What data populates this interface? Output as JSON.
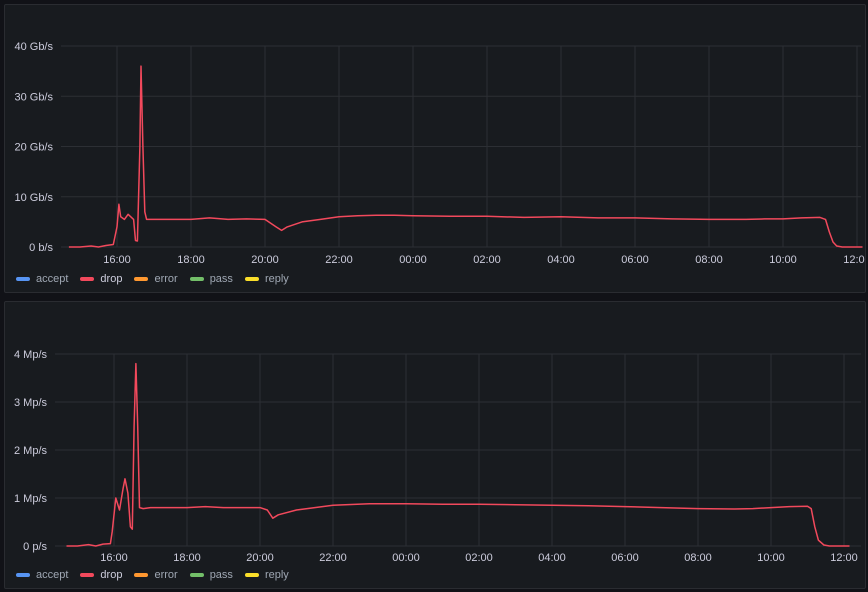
{
  "colors": {
    "accept": "#5794f2",
    "drop": "#f2495c",
    "error": "#ff9830",
    "pass": "#73bf69",
    "reply": "#fade2a"
  },
  "chart_data": [
    {
      "type": "line",
      "title": "",
      "xlabel": "",
      "ylabel": "",
      "unit": "b/s",
      "x_ticks": [
        "16:00",
        "18:00",
        "20:00",
        "22:00",
        "00:00",
        "02:00",
        "04:00",
        "06:00",
        "08:00",
        "10:00",
        "12:00"
      ],
      "y_ticks": [
        "0 b/s",
        "10 Gb/s",
        "20 Gb/s",
        "30 Gb/s",
        "40 Gb/s"
      ],
      "ylim_gbps": [
        0,
        40
      ],
      "xlim_hours": [
        14.7,
        36.15
      ],
      "grid": true,
      "legend_position": "bottom-left",
      "legend": [
        "accept",
        "drop",
        "error",
        "pass",
        "reply"
      ],
      "series": [
        {
          "name": "drop",
          "y_unit": "Gb/s",
          "points": [
            [
              14.7,
              0
            ],
            [
              15.0,
              0
            ],
            [
              15.3,
              0.2
            ],
            [
              15.5,
              0
            ],
            [
              15.7,
              0.3
            ],
            [
              15.9,
              0.5
            ],
            [
              16.0,
              4
            ],
            [
              16.05,
              8.5
            ],
            [
              16.1,
              6
            ],
            [
              16.2,
              5.5
            ],
            [
              16.3,
              6.5
            ],
            [
              16.45,
              5.5
            ],
            [
              16.5,
              1.3
            ],
            [
              16.55,
              1.2
            ],
            [
              16.62,
              20
            ],
            [
              16.65,
              36
            ],
            [
              16.7,
              20
            ],
            [
              16.75,
              7
            ],
            [
              16.8,
              5.5
            ],
            [
              17.0,
              5.5
            ],
            [
              17.5,
              5.5
            ],
            [
              18.0,
              5.5
            ],
            [
              18.5,
              5.8
            ],
            [
              19.0,
              5.5
            ],
            [
              19.5,
              5.6
            ],
            [
              20.0,
              5.5
            ],
            [
              20.3,
              4
            ],
            [
              20.45,
              3.3
            ],
            [
              20.6,
              4
            ],
            [
              21.0,
              5
            ],
            [
              21.5,
              5.5
            ],
            [
              22.0,
              6
            ],
            [
              22.5,
              6.2
            ],
            [
              23.0,
              6.3
            ],
            [
              23.5,
              6.3
            ],
            [
              24.0,
              6.2
            ],
            [
              25.0,
              6.1
            ],
            [
              26.0,
              6.1
            ],
            [
              27.0,
              5.9
            ],
            [
              28.0,
              6
            ],
            [
              29.0,
              5.8
            ],
            [
              30.0,
              5.8
            ],
            [
              31.0,
              5.6
            ],
            [
              32.0,
              5.5
            ],
            [
              33.0,
              5.5
            ],
            [
              33.5,
              5.6
            ],
            [
              34.0,
              5.6
            ],
            [
              34.5,
              5.8
            ],
            [
              35.0,
              5.9
            ],
            [
              35.15,
              5.5
            ],
            [
              35.25,
              3
            ],
            [
              35.35,
              1
            ],
            [
              35.45,
              0.2
            ],
            [
              35.6,
              0
            ],
            [
              36.15,
              0
            ]
          ]
        }
      ]
    },
    {
      "type": "line",
      "title": "",
      "xlabel": "",
      "ylabel": "",
      "unit": "p/s",
      "x_ticks": [
        "16:00",
        "18:00",
        "20:00",
        "22:00",
        "00:00",
        "02:00",
        "04:00",
        "06:00",
        "08:00",
        "10:00",
        "12:00"
      ],
      "y_ticks": [
        "0 p/s",
        "1 Mp/s",
        "2 Mp/s",
        "3 Mp/s",
        "4 Mp/s"
      ],
      "ylim_mpps": [
        0,
        4
      ],
      "xlim_hours": [
        14.7,
        36.15
      ],
      "grid": true,
      "legend_position": "bottom-left",
      "legend": [
        "accept",
        "drop",
        "error",
        "pass",
        "reply"
      ],
      "series": [
        {
          "name": "drop",
          "y_unit": "Mp/s",
          "points": [
            [
              14.7,
              0
            ],
            [
              15.0,
              0
            ],
            [
              15.3,
              0.03
            ],
            [
              15.5,
              0
            ],
            [
              15.7,
              0.04
            ],
            [
              15.9,
              0.05
            ],
            [
              15.95,
              0.3
            ],
            [
              16.05,
              1.0
            ],
            [
              16.15,
              0.75
            ],
            [
              16.25,
              1.2
            ],
            [
              16.3,
              1.4
            ],
            [
              16.38,
              1.1
            ],
            [
              16.45,
              0.4
            ],
            [
              16.5,
              0.35
            ],
            [
              16.55,
              2.5
            ],
            [
              16.6,
              3.8
            ],
            [
              16.65,
              2.5
            ],
            [
              16.7,
              0.8
            ],
            [
              16.8,
              0.78
            ],
            [
              17.0,
              0.8
            ],
            [
              17.5,
              0.8
            ],
            [
              18.0,
              0.8
            ],
            [
              18.5,
              0.82
            ],
            [
              19.0,
              0.8
            ],
            [
              19.5,
              0.8
            ],
            [
              20.0,
              0.8
            ],
            [
              20.2,
              0.75
            ],
            [
              20.35,
              0.58
            ],
            [
              20.5,
              0.65
            ],
            [
              21.0,
              0.75
            ],
            [
              21.5,
              0.8
            ],
            [
              22.0,
              0.85
            ],
            [
              23.0,
              0.88
            ],
            [
              24.0,
              0.88
            ],
            [
              25.0,
              0.87
            ],
            [
              26.0,
              0.87
            ],
            [
              27.0,
              0.86
            ],
            [
              28.0,
              0.85
            ],
            [
              29.0,
              0.84
            ],
            [
              30.0,
              0.82
            ],
            [
              31.0,
              0.8
            ],
            [
              32.0,
              0.78
            ],
            [
              33.0,
              0.77
            ],
            [
              33.5,
              0.78
            ],
            [
              34.0,
              0.8
            ],
            [
              34.5,
              0.82
            ],
            [
              35.0,
              0.83
            ],
            [
              35.1,
              0.78
            ],
            [
              35.2,
              0.4
            ],
            [
              35.3,
              0.12
            ],
            [
              35.45,
              0.02
            ],
            [
              35.6,
              0
            ],
            [
              36.15,
              0
            ]
          ]
        }
      ]
    }
  ]
}
